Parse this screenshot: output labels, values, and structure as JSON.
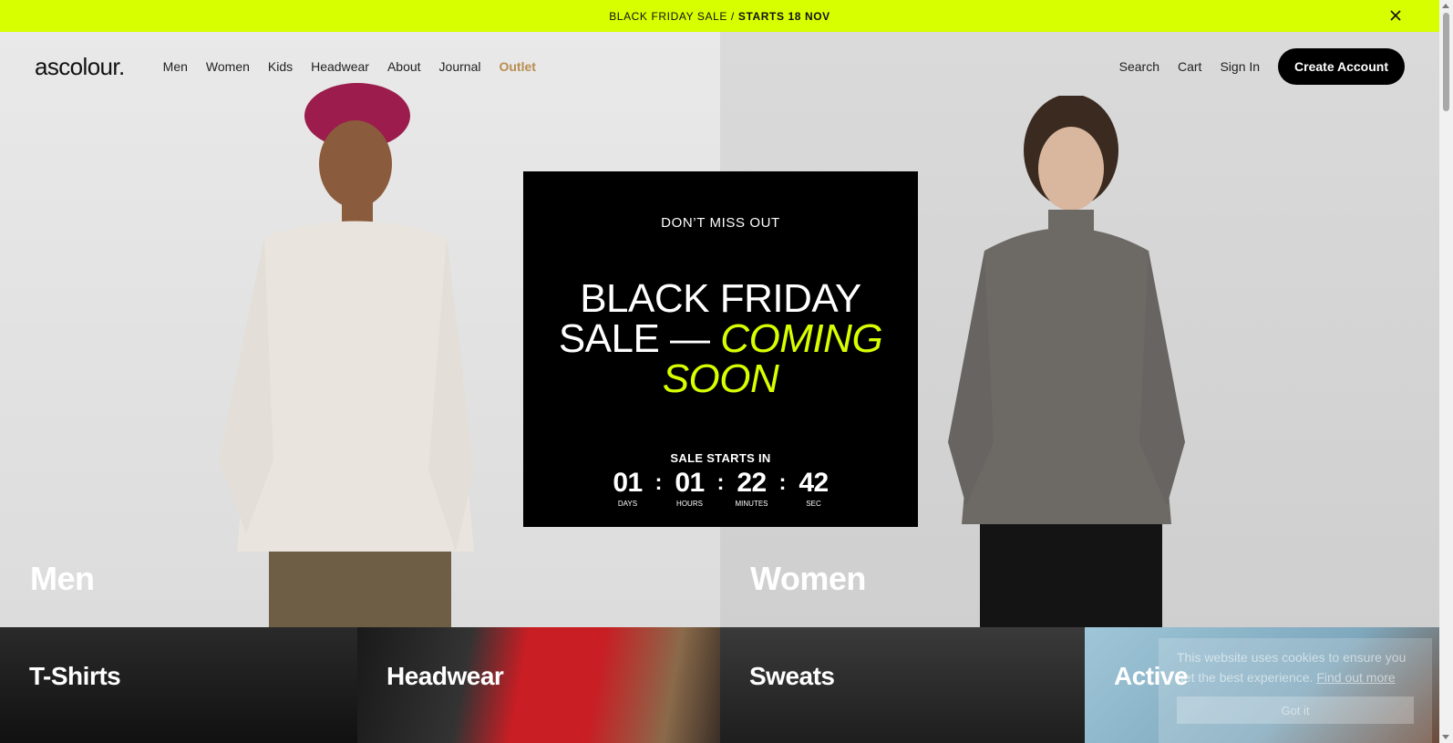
{
  "announcement": {
    "text": "BLACK FRIDAY SALE /",
    "highlight": "STARTS 18 NOV"
  },
  "header": {
    "logo": "ascolour.",
    "nav": [
      "Men",
      "Women",
      "Kids",
      "Headwear",
      "About",
      "Journal"
    ],
    "outlet": "Outlet",
    "search": "Search",
    "cart": "Cart",
    "sign_in": "Sign In",
    "create_account": "Create Account"
  },
  "hero": {
    "left_label": "Men",
    "right_label": "Women"
  },
  "promo": {
    "eyebrow": "DON’T MISS OUT",
    "title_line1": "BLACK FRIDAY",
    "title_line2a": "SALE —",
    "title_line2b": "COMING",
    "title_line3": "SOON",
    "starts_label": "SALE STARTS IN",
    "countdown": {
      "days": "01",
      "days_label": "DAYS",
      "hours": "01",
      "hours_label": "HOURS",
      "minutes": "22",
      "minutes_label": "MINUTES",
      "seconds": "42",
      "seconds_label": "SEC"
    }
  },
  "tiles": [
    "T-Shirts",
    "Headwear",
    "Sweats",
    "Active"
  ],
  "cookie": {
    "text": "This website uses cookies to ensure you get the best experience.",
    "link": "Find out more",
    "accept": "Got it"
  },
  "colors": {
    "accent": "#d8ff00",
    "outlet": "#b88d4f",
    "button": "#000000"
  }
}
